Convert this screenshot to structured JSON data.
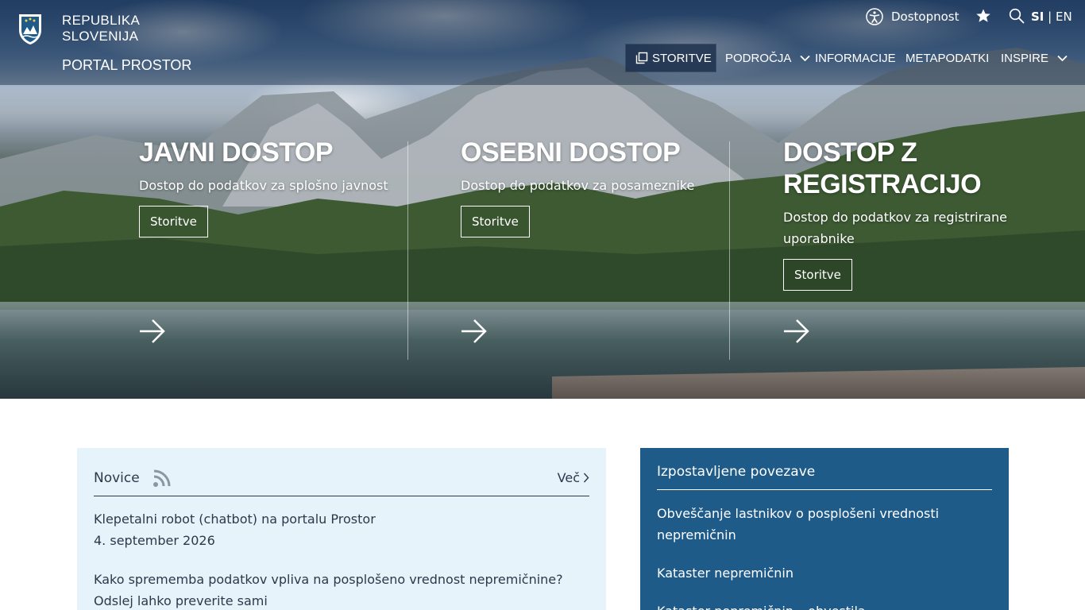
{
  "header": {
    "brand_line1": "REPUBLIKA",
    "brand_line2": "SLOVENIJA",
    "portal_name": "PORTAL PROSTOR",
    "accessibility": "Dostopnost",
    "lang_si": "SI",
    "lang_sep": "|",
    "lang_en": "EN",
    "nav": {
      "storitve": "STORITVE",
      "podrocja": "PODROČJA",
      "informacije": "INFORMACIJE",
      "metapodatki": "METAPODATKI",
      "inspire": "INSPIRE"
    }
  },
  "hero": {
    "columns": [
      {
        "title": "JAVNI DOSTOP",
        "desc": "Dostop do podatkov za splošno javnost",
        "button": "Storitve"
      },
      {
        "title": "OSEBNI DOSTOP",
        "desc": "Dostop do podatkov za posameznike",
        "button": "Storitve"
      },
      {
        "title_line1": "DOSTOP Z",
        "title_line2": "REGISTRACIJO",
        "desc": "Dostop do podatkov za registrirane uporabnike",
        "button": "Storitve"
      }
    ]
  },
  "news": {
    "title": "Novice",
    "more": "Več",
    "items": [
      {
        "headline": "Klepetalni robot (chatbot) na portalu Prostor",
        "date": "4. september 2026"
      },
      {
        "headline": "Kako sprememba podatkov vpliva na posplošeno vrednost nepremičnine? Odslej lahko preverite sami"
      }
    ]
  },
  "featured": {
    "title": "Izpostavljene povezave",
    "items": [
      "Obveščanje lastnikov o posplošeni vrednosti nepremičnin",
      "Kataster nepremičnin",
      "Kataster nepremičnin – obvestila"
    ]
  },
  "colors": {
    "header_overlay": "#0f233c",
    "news_bg": "#e6f3fb",
    "featured_bg": "#1f5b89",
    "text": "#2b3a4a"
  }
}
